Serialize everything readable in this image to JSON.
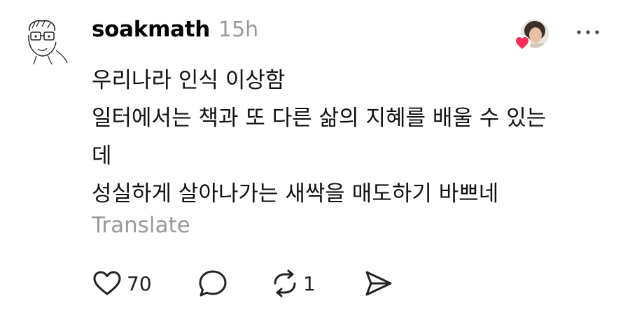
{
  "post": {
    "author": "soakmath",
    "time": "15h",
    "lines": [
      "우리나라 인식 이상함",
      "일터에서는 책과 또 다른 삶의 지혜를 배울 수 있는",
      "데",
      "성실하게 살아나가는 새싹을 매도하기 바쁘네"
    ],
    "translate_label": "Translate"
  },
  "actions": {
    "like_count": "70",
    "repost_count": "1"
  },
  "icons": {
    "like": "heart-icon",
    "comment": "comment-bubble-icon",
    "repost": "repost-icon",
    "share": "send-icon",
    "more": "more-dots-icon"
  },
  "colors": {
    "heart_badge": "#ff2d55",
    "muted_text": "#999999"
  }
}
